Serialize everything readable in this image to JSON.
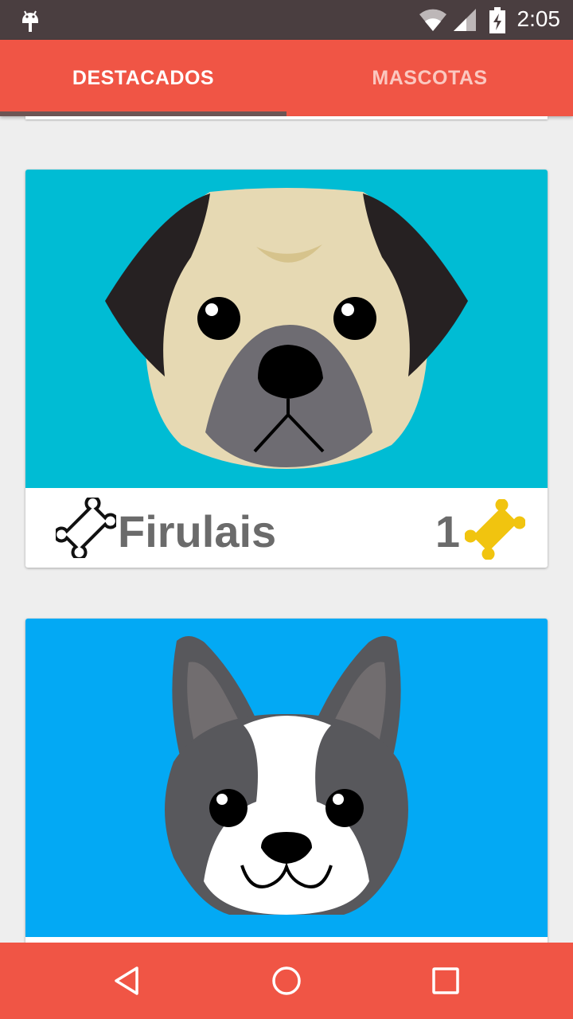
{
  "status_bar": {
    "time": "2:05",
    "icons": [
      "android-icon",
      "wifi-icon",
      "signal-icon",
      "battery-charging-icon"
    ]
  },
  "tabs": [
    {
      "label": "DESTACADOS",
      "active": true
    },
    {
      "label": "MASCOTAS",
      "active": false
    }
  ],
  "pets": [
    {
      "name": "Firulais",
      "rating": "1",
      "image": "pug-face",
      "background": "#00bcd4"
    },
    {
      "name": "",
      "rating": "",
      "image": "boston-terrier-face",
      "background": "#03a9f4"
    }
  ],
  "nav": {
    "icons": [
      "back-icon",
      "home-icon",
      "recents-icon"
    ]
  },
  "colors": {
    "primary": "#f05545",
    "status_bar": "#4a3e40",
    "text_gray": "#6b6b6b",
    "bone_gold": "#f1c40f"
  }
}
